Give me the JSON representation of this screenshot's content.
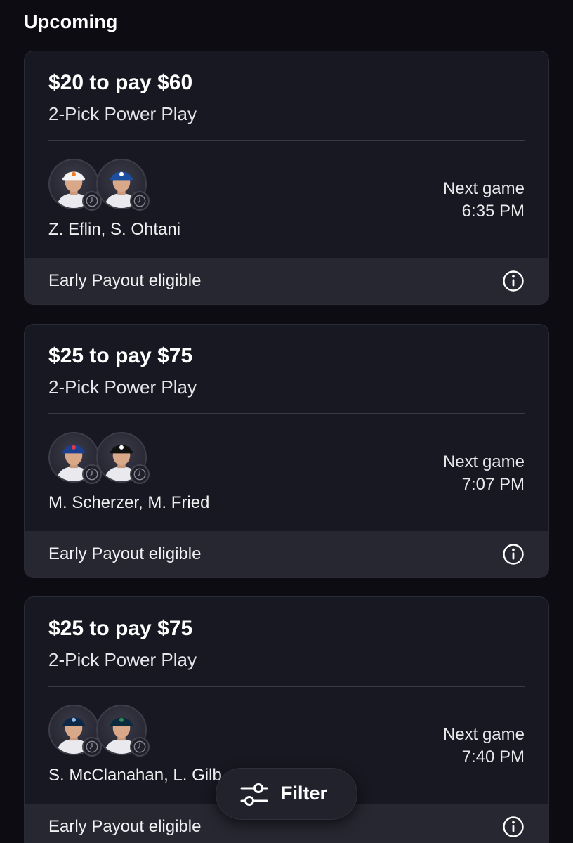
{
  "header": {
    "title": "Upcoming"
  },
  "entries": [
    {
      "wager": "$20 to pay $60",
      "play_type": "2-Pick Power Play",
      "players": "Z. Eflin, S. Ohtani",
      "next_game_label": "Next game",
      "next_game_time": "6:35 PM",
      "footer": "Early Payout eligible",
      "avatars": [
        {
          "icon": "player-headshot",
          "cap_color": "#f4f4f4",
          "logo_color": "#f07a1f"
        },
        {
          "icon": "player-headshot",
          "cap_color": "#1d4fa0",
          "logo_color": "#ffffff"
        }
      ]
    },
    {
      "wager": "$25 to pay $75",
      "play_type": "2-Pick Power Play",
      "players": "M. Scherzer, M. Fried",
      "next_game_label": "Next game",
      "next_game_time": "7:07 PM",
      "footer": "Early Payout eligible",
      "avatars": [
        {
          "icon": "player-headshot",
          "cap_color": "#1c3f8f",
          "logo_color": "#e03a3e"
        },
        {
          "icon": "player-headshot",
          "cap_color": "#111111",
          "logo_color": "#ffffff"
        }
      ]
    },
    {
      "wager": "$25 to pay $75",
      "play_type": "2-Pick Power Play",
      "players": "S. McClanahan, L. Gilb",
      "next_game_label": "Next game",
      "next_game_time": "7:40 PM",
      "footer": "Early Payout eligible",
      "avatars": [
        {
          "icon": "player-headshot",
          "cap_color": "#0d2747",
          "logo_color": "#8fbce6"
        },
        {
          "icon": "player-headshot",
          "cap_color": "#0b2b3d",
          "logo_color": "#2e8b57"
        }
      ]
    }
  ],
  "filter": {
    "label": "Filter",
    "icon": "sliders-icon"
  },
  "colors": {
    "background": "#0c0c12",
    "card": "#181822",
    "card_footer": "#272732",
    "text": "#ffffff"
  }
}
